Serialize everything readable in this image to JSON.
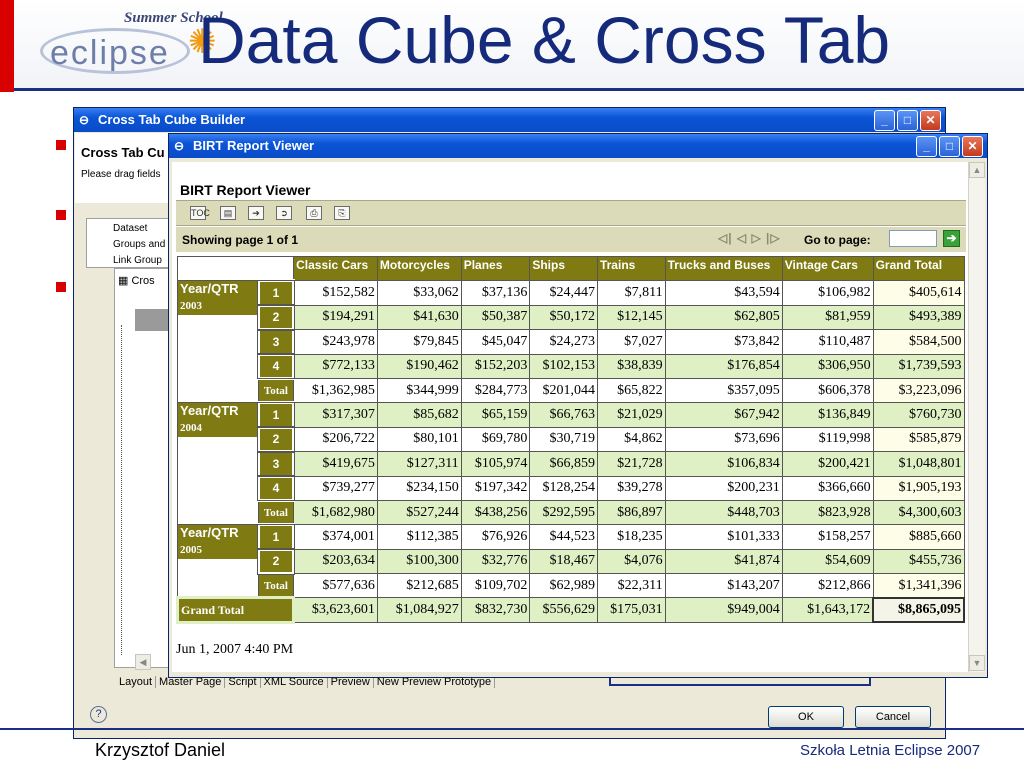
{
  "slide": {
    "title": "Data Cube & Cross Tab",
    "logo_top": "Summer School",
    "logo_word": "eclipse",
    "footer_author": "Krzysztof Daniel",
    "footer_school": "Szkoła Letnia Eclipse 2007"
  },
  "back_window": {
    "title": "Cross Tab Cube Builder",
    "heading": "Cross Tab Cu",
    "desc": "Please drag fields",
    "tree": [
      "Dataset",
      "Groups and",
      "Link Group"
    ],
    "inner_tab": "Cros",
    "tabs": [
      "Layout",
      "Master Page",
      "Script",
      "XML Source",
      "Preview",
      "New Preview Prototype"
    ],
    "ok": "OK",
    "cancel": "Cancel",
    "help": "?"
  },
  "viewer": {
    "title": "BIRT Report Viewer",
    "heading": "BIRT Report Viewer",
    "showing": "Showing page  1  of  1",
    "nav": "◁| ◁  ▷ |▷",
    "goto": "Go to page:",
    "toc": "TOC",
    "footer_time": "Jun 1, 2007 4:40 PM"
  },
  "crosstab": {
    "columns": [
      "Classic Cars",
      "Motorcycles",
      "Planes",
      "Ships",
      "Trains",
      "Trucks and Buses",
      "Vintage Cars",
      "Grand Total"
    ],
    "row_header": "Year/QTR",
    "total_label": "Total",
    "grand_total_label": "Grand Total",
    "years": [
      {
        "year": "2003",
        "rows": [
          {
            "q": "1",
            "values": [
              "$152,582",
              "$33,062",
              "$37,136",
              "$24,447",
              "$7,811",
              "$43,594",
              "$106,982",
              "$405,614"
            ]
          },
          {
            "q": "2",
            "values": [
              "$194,291",
              "$41,630",
              "$50,387",
              "$50,172",
              "$12,145",
              "$62,805",
              "$81,959",
              "$493,389"
            ]
          },
          {
            "q": "3",
            "values": [
              "$243,978",
              "$79,845",
              "$45,047",
              "$24,273",
              "$7,027",
              "$73,842",
              "$110,487",
              "$584,500"
            ]
          },
          {
            "q": "4",
            "values": [
              "$772,133",
              "$190,462",
              "$152,203",
              "$102,153",
              "$38,839",
              "$176,854",
              "$306,950",
              "$1,739,593"
            ]
          }
        ],
        "total": [
          "$1,362,985",
          "$344,999",
          "$284,773",
          "$201,044",
          "$65,822",
          "$357,095",
          "$606,378",
          "$3,223,096"
        ]
      },
      {
        "year": "2004",
        "rows": [
          {
            "q": "1",
            "values": [
              "$317,307",
              "$85,682",
              "$65,159",
              "$66,763",
              "$21,029",
              "$67,942",
              "$136,849",
              "$760,730"
            ]
          },
          {
            "q": "2",
            "values": [
              "$206,722",
              "$80,101",
              "$69,780",
              "$30,719",
              "$4,862",
              "$73,696",
              "$119,998",
              "$585,879"
            ]
          },
          {
            "q": "3",
            "values": [
              "$419,675",
              "$127,311",
              "$105,974",
              "$66,859",
              "$21,728",
              "$106,834",
              "$200,421",
              "$1,048,801"
            ]
          },
          {
            "q": "4",
            "values": [
              "$739,277",
              "$234,150",
              "$197,342",
              "$128,254",
              "$39,278",
              "$200,231",
              "$366,660",
              "$1,905,193"
            ]
          }
        ],
        "total": [
          "$1,682,980",
          "$527,244",
          "$438,256",
          "$292,595",
          "$86,897",
          "$448,703",
          "$823,928",
          "$4,300,603"
        ]
      },
      {
        "year": "2005",
        "rows": [
          {
            "q": "1",
            "values": [
              "$374,001",
              "$112,385",
              "$76,926",
              "$44,523",
              "$18,235",
              "$101,333",
              "$158,257",
              "$885,660"
            ]
          },
          {
            "q": "2",
            "values": [
              "$203,634",
              "$100,300",
              "$32,776",
              "$18,467",
              "$4,076",
              "$41,874",
              "$54,609",
              "$455,736"
            ]
          }
        ],
        "total": [
          "$577,636",
          "$212,685",
          "$109,702",
          "$62,989",
          "$22,311",
          "$143,207",
          "$212,866",
          "$1,341,396"
        ]
      }
    ],
    "grand_total": [
      "$3,623,601",
      "$1,084,927",
      "$832,730",
      "$556,629",
      "$175,031",
      "$949,004",
      "$1,643,172",
      "$8,865,095"
    ]
  }
}
